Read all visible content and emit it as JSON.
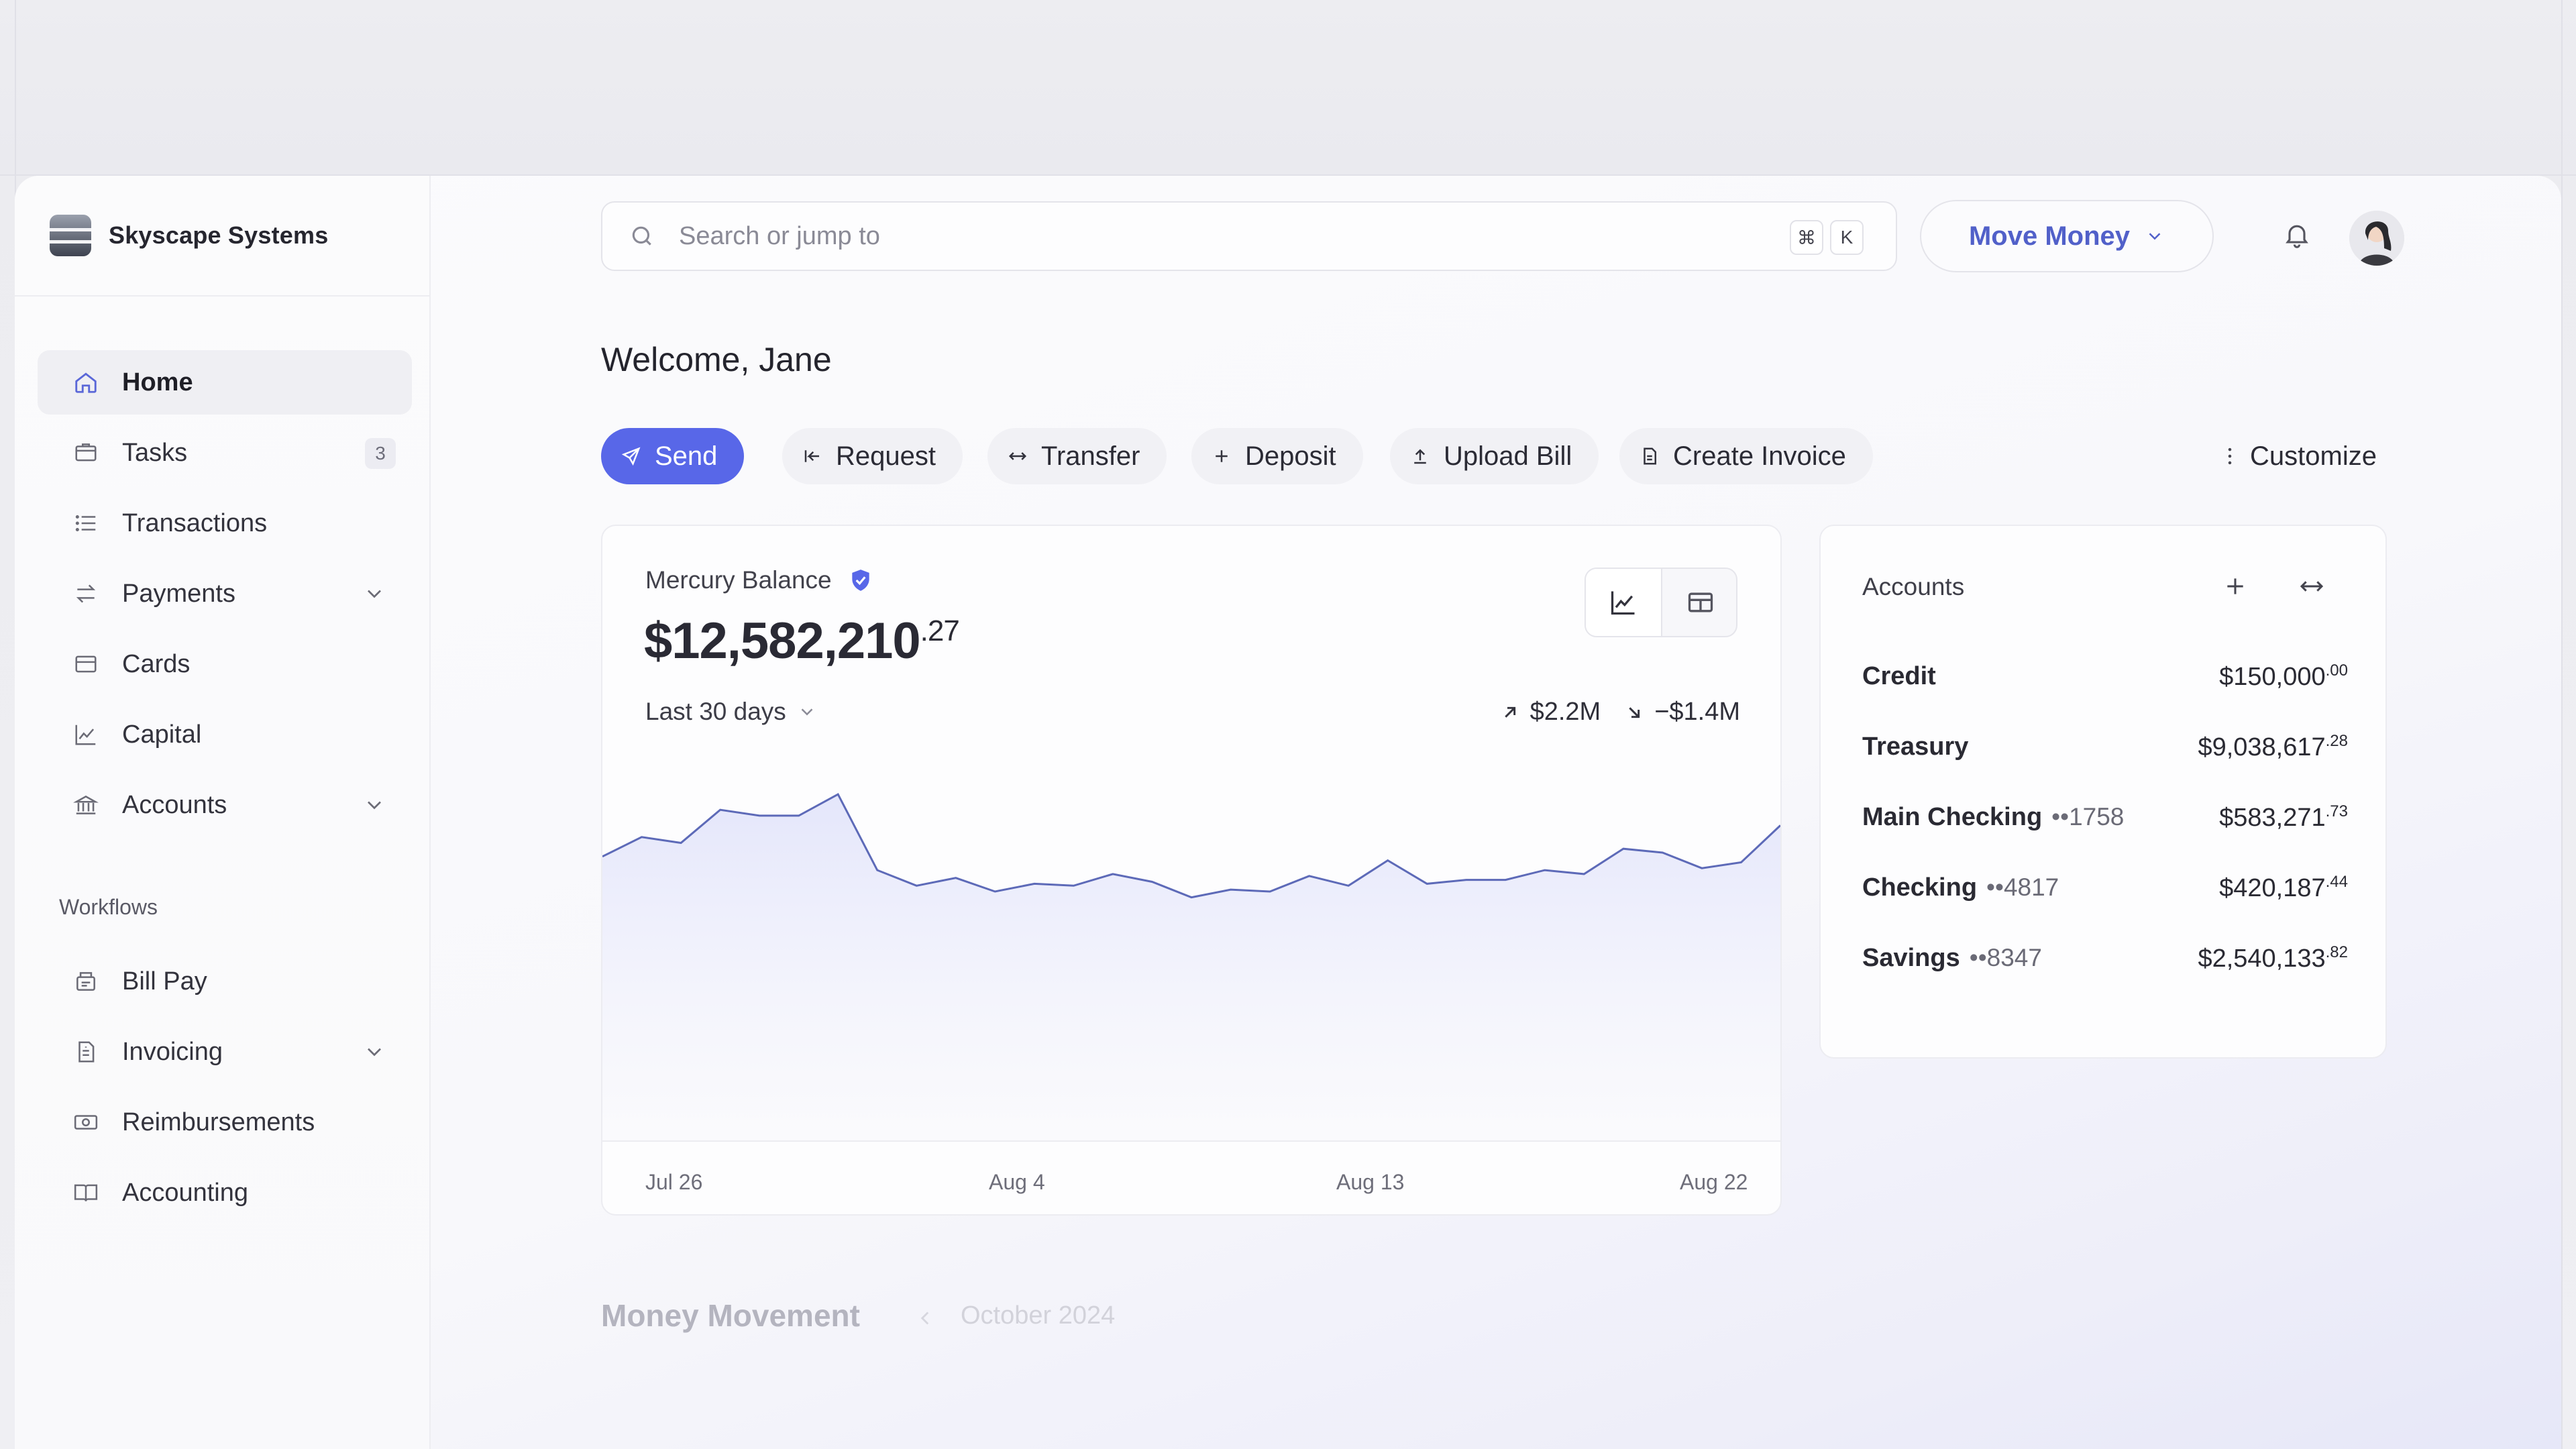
{
  "org": {
    "name": "Skyscape Systems"
  },
  "sidebar": {
    "items": [
      {
        "label": "Home",
        "icon": "home-icon",
        "active": true
      },
      {
        "label": "Tasks",
        "icon": "tasks-icon",
        "badge": "3"
      },
      {
        "label": "Transactions",
        "icon": "list-icon"
      },
      {
        "label": "Payments",
        "icon": "transfer-arrows-icon",
        "expandable": true
      },
      {
        "label": "Cards",
        "icon": "card-icon"
      },
      {
        "label": "Capital",
        "icon": "chart-line-icon"
      },
      {
        "label": "Accounts",
        "icon": "bank-icon",
        "expandable": true
      }
    ],
    "workflows_label": "Workflows",
    "workflows": [
      {
        "label": "Bill Pay",
        "icon": "bill-icon"
      },
      {
        "label": "Invoicing",
        "icon": "invoice-icon",
        "expandable": true
      },
      {
        "label": "Reimbursements",
        "icon": "cash-icon"
      },
      {
        "label": "Accounting",
        "icon": "book-icon"
      }
    ]
  },
  "header": {
    "search_placeholder": "Search or jump to",
    "shortcut_cmd": "⌘",
    "shortcut_key": "K",
    "move_money": "Move Money"
  },
  "main": {
    "welcome": "Welcome, Jane",
    "actions": [
      "Send",
      "Request",
      "Transfer",
      "Deposit",
      "Upload Bill",
      "Create Invoice"
    ],
    "customize": "Customize"
  },
  "balance": {
    "label": "Mercury Balance",
    "amount_whole": "$12,582,210",
    "amount_cents": ".27",
    "period": "Last 30 days",
    "inflow": "$2.2M",
    "outflow": "−$1.4M"
  },
  "chart_data": {
    "type": "area",
    "xlabel": "",
    "ylabel": "",
    "x_tick_labels": [
      "Jul 26",
      "Aug 4",
      "Aug 13",
      "Aug 22"
    ],
    "values": [
      0.68,
      0.78,
      0.75,
      0.92,
      0.89,
      0.89,
      1.0,
      0.61,
      0.53,
      0.57,
      0.5,
      0.54,
      0.53,
      0.59,
      0.55,
      0.47,
      0.51,
      0.5,
      0.58,
      0.53,
      0.66,
      0.54,
      0.56,
      0.56,
      0.61,
      0.59,
      0.72,
      0.7,
      0.62,
      0.65,
      0.84
    ],
    "grid": false,
    "color": "#5d6ab8"
  },
  "accounts": {
    "title": "Accounts",
    "rows": [
      {
        "name": "Credit",
        "mask": "",
        "whole": "$150,000",
        "cents": ".00"
      },
      {
        "name": "Treasury",
        "mask": "",
        "whole": "$9,038,617",
        "cents": ".28"
      },
      {
        "name": "Main Checking",
        "mask": "••1758",
        "whole": "$583,271",
        "cents": ".73"
      },
      {
        "name": "Checking",
        "mask": "••4817",
        "whole": "$420,187",
        "cents": ".44"
      },
      {
        "name": "Savings",
        "mask": "••8347",
        "whole": "$2,540,133",
        "cents": ".82"
      }
    ]
  },
  "money_movement": {
    "title": "Money Movement",
    "date": "October 2024"
  },
  "colors": {
    "accent": "#5867e8",
    "accent_text": "#5160c9"
  }
}
